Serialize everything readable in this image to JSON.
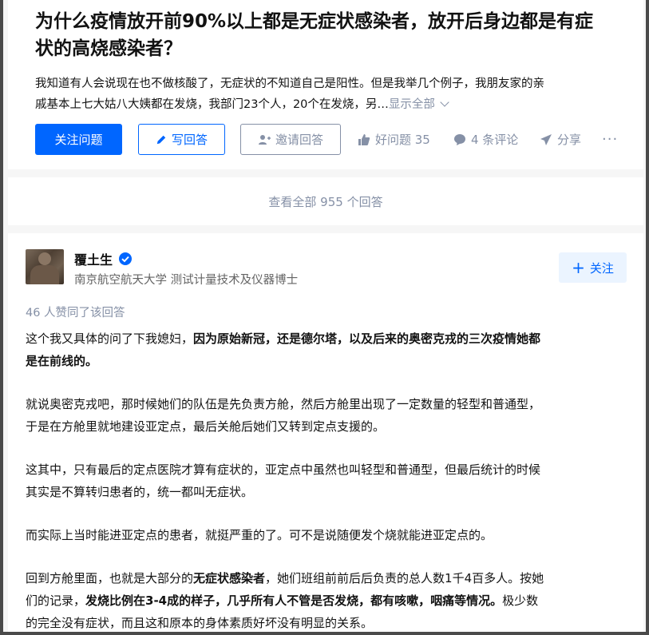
{
  "question": {
    "title_lines": [
      "为什么疫情放开前90%以上都是无症状感染者，放开后身边都是有症",
      "状的高烧感染者？"
    ],
    "detail_line1": "我知道有人会说现在也不做核酸了，无症状的不知道自己是阳性。但是我举几个例子，我朋友家的亲",
    "detail_line2": "戚基本上七大姑八大姨都在发烧，我部门23个人，20个在发烧，另…",
    "show_all": "显示全部"
  },
  "actions": {
    "follow_question": "关注问题",
    "write_answer": "写回答",
    "invite_answer": "邀请回答",
    "good_question": "好问题 35",
    "comments": "4 条评论",
    "share": "分享",
    "more": "···"
  },
  "answers_link": "查看全部 955 个回答",
  "answer": {
    "author_name": "覆土生",
    "author_bio": "南京航空航天大学 测试计量技术及仪器博士",
    "follow_label": "关注",
    "votes_text": "46 人赞同了该回答",
    "p1_l1_a": "这个我又具体的问了下我媳妇，",
    "p1_l1_b": "因为原始新冠，还是德尔塔，以及后来的奥密克戎的三次疫情她都",
    "p1_l2_b": "是在前线的。",
    "p2_l1": "就说奥密克戎吧，那时候她们的队伍是先负责方舱，然后方舱里出现了一定数量的轻型和普通型，",
    "p2_l2": "于是在方舱里就地建设亚定点，最后关舱后她们又转到定点支援的。",
    "p3_l1": "这其中，只有最后的定点医院才算有症状的，亚定点中虽然也叫轻型和普通型，但最后统计的时候",
    "p3_l2": "其实是不算转归患者的，统一都叫无症状。",
    "p4_l1": "而实际上当时能进亚定点的患者，就挺严重的了。可不是说随便发个烧就能进亚定点的。",
    "p5_l1_a": "回到方舱里面，也就是大部分的",
    "p5_l1_b": "无症状感染者",
    "p5_l1_c": "，她们班组前前后后负责的总人数1千4百多人。按她",
    "p5_l2_a": "们的记录，",
    "p5_l2_b": "发烧比例在3-4成的样子，几乎所有人不管是否发烧，都有咳嗽，咽痛等情况。",
    "p5_l2_c": "极少数",
    "p5_l3": "的完全没有症状，而且这和原本的身体素质好坏没有明显的关系。"
  },
  "colors": {
    "brand": "#0066ff",
    "muted": "#8590a6",
    "text": "#121212"
  }
}
